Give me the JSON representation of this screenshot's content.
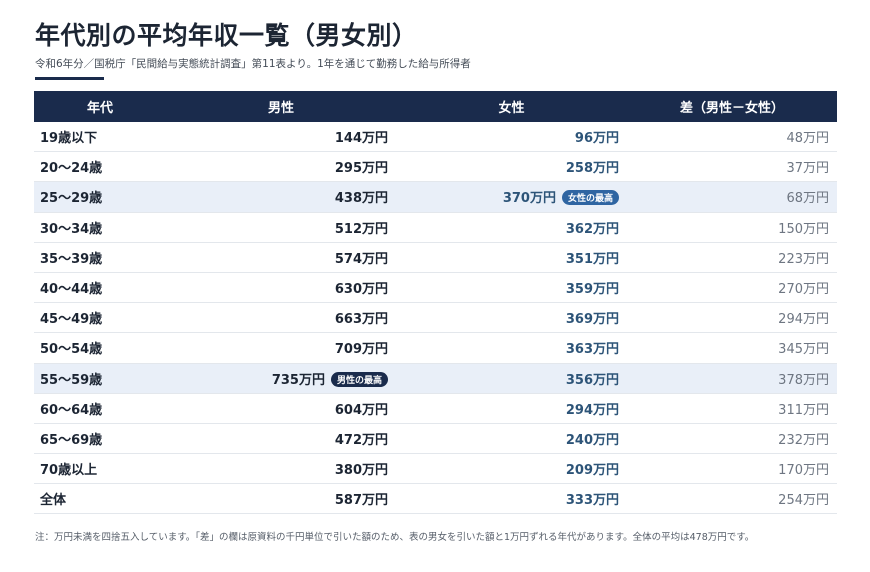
{
  "title": "年代別の平均年収一覧（男女別）",
  "subtitle": "令和6年分／国税庁「民間給与実態統計調査」第11表より。1年を通じて勤務した給与所得者",
  "table": {
    "headers": [
      "年代",
      "男性",
      "女性",
      "差（男性－女性）"
    ],
    "rows": [
      {
        "age": "19歳以下",
        "male": "144万円",
        "female": "96万円",
        "diff": "48万円"
      },
      {
        "age": "20～24歳",
        "male": "295万円",
        "female": "258万円",
        "diff": "37万円"
      },
      {
        "age": "25～29歳",
        "male": "438万円",
        "female": "370万円",
        "diff": "68万円",
        "female_badge": "女性の最高",
        "highlight": true
      },
      {
        "age": "30～34歳",
        "male": "512万円",
        "female": "362万円",
        "diff": "150万円"
      },
      {
        "age": "35～39歳",
        "male": "574万円",
        "female": "351万円",
        "diff": "223万円"
      },
      {
        "age": "40～44歳",
        "male": "630万円",
        "female": "359万円",
        "diff": "270万円"
      },
      {
        "age": "45～49歳",
        "male": "663万円",
        "female": "369万円",
        "diff": "294万円"
      },
      {
        "age": "50～54歳",
        "male": "709万円",
        "female": "363万円",
        "diff": "345万円"
      },
      {
        "age": "55～59歳",
        "male": "735万円",
        "female": "356万円",
        "diff": "378万円",
        "male_badge": "男性の最高",
        "highlight": true
      },
      {
        "age": "60～64歳",
        "male": "604万円",
        "female": "294万円",
        "diff": "311万円"
      },
      {
        "age": "65～69歳",
        "male": "472万円",
        "female": "240万円",
        "diff": "232万円"
      },
      {
        "age": "70歳以上",
        "male": "380万円",
        "female": "209万円",
        "diff": "170万円"
      },
      {
        "age": "全体",
        "male": "587万円",
        "female": "333万円",
        "diff": "254万円"
      }
    ]
  },
  "note": "注：万円未満を四捨五入しています。「差」の欄は原資料の千円単位で引いた額のため、表の男女を引いた額と1万円ずれる年代があります。全体の平均は478万円です。",
  "colors": {
    "header_bg": "#1a2b4c",
    "highlight_row": "#e9eff8",
    "female_text": "#2d5478",
    "male_badge": "#1a2b4c",
    "female_badge": "#2f65a2"
  }
}
